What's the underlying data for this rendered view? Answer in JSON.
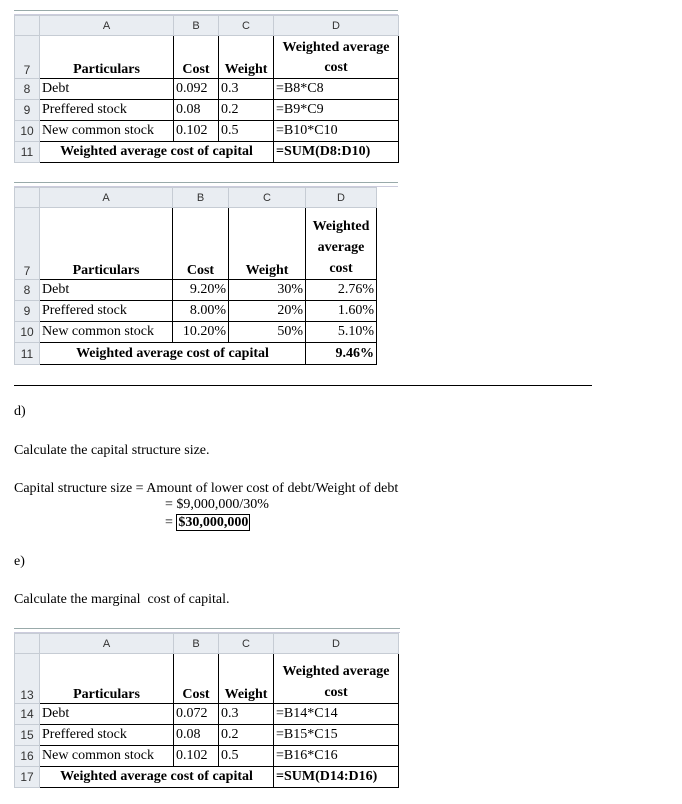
{
  "columns": [
    "A",
    "B",
    "C",
    "D"
  ],
  "table1": {
    "header_row": "7",
    "headers": [
      "Particulars",
      "Cost",
      "Weight",
      "Weighted average cost"
    ],
    "rows": [
      {
        "num": "8",
        "a": "Debt",
        "b": "0.092",
        "c": "0.3",
        "d": "=B8*C8"
      },
      {
        "num": "9",
        "a": "Preffered stock",
        "b": "0.08",
        "c": "0.2",
        "d": "=B9*C9"
      },
      {
        "num": "10",
        "a": "New common stock",
        "b": "0.102",
        "c": "0.5",
        "d": "=B10*C10"
      }
    ],
    "total": {
      "num": "11",
      "label": "Weighted average cost of capital",
      "value": "=SUM(D8:D10)"
    }
  },
  "table2": {
    "header_row": "7",
    "headers": [
      "Particulars",
      "Cost",
      "Weight",
      "Weighted average cost"
    ],
    "rows": [
      {
        "num": "8",
        "a": "Debt",
        "b": "9.20%",
        "c": "30%",
        "d": "2.76%"
      },
      {
        "num": "9",
        "a": "Preffered stock",
        "b": "8.00%",
        "c": "20%",
        "d": "1.60%"
      },
      {
        "num": "10",
        "a": "New common stock",
        "b": "10.20%",
        "c": "50%",
        "d": "5.10%"
      }
    ],
    "total": {
      "num": "11",
      "label": "Weighted average cost of capital",
      "value": "9.46%"
    }
  },
  "section_d": {
    "label": "d)",
    "question": "Calculate the capital structure size.",
    "line1": "Capital structure size = Amount of lower cost of debt/Weight of debt",
    "line2": "= $9,000,000/30%",
    "line3_prefix": "=",
    "answer": "$30,000,000"
  },
  "section_e": {
    "label": "e)",
    "question": "Calculate the marginal  cost of capital."
  },
  "table3": {
    "header_row": "13",
    "headers": [
      "Particulars",
      "Cost",
      "Weight",
      "Weighted average cost"
    ],
    "rows": [
      {
        "num": "14",
        "a": "Debt",
        "b": "0.072",
        "c": "0.3",
        "d": "=B14*C14"
      },
      {
        "num": "15",
        "a": "Preffered stock",
        "b": "0.08",
        "c": "0.2",
        "d": "=B15*C15"
      },
      {
        "num": "16",
        "a": "New common stock",
        "b": "0.102",
        "c": "0.5",
        "d": "=B16*C16"
      }
    ],
    "total": {
      "num": "17",
      "label": "Weighted average cost of capital",
      "value": "=SUM(D14:D16)"
    }
  }
}
